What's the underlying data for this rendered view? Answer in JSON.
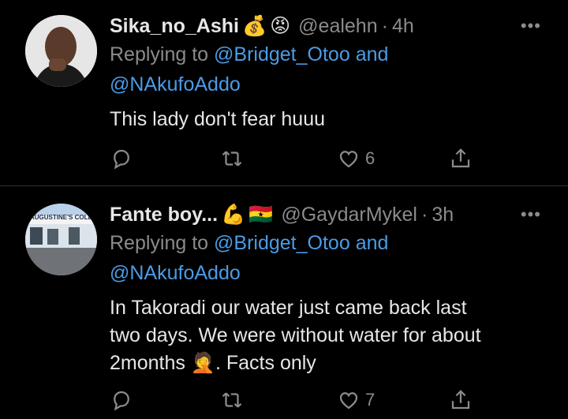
{
  "tweets": [
    {
      "name": "Sika_no_Ashi",
      "emojis": [
        "💰",
        "😡"
      ],
      "handle": "@ealehn",
      "time": "4h",
      "replying_prefix": "Replying to",
      "mention1": "@Bridget_Otoo",
      "and": "and",
      "mention2": "@NAkufoAddo",
      "text": "This lady don't fear huuu",
      "likes": "6"
    },
    {
      "name": "Fante boy...",
      "emojis": [
        "💪",
        "🇬🇭"
      ],
      "handle": "@GaydarMykel",
      "time": "3h",
      "replying_prefix": "Replying to",
      "mention1": "@Bridget_Otoo",
      "and": "and",
      "mention2": "@NAkufoAddo",
      "text_line1": "In Takoradi our water just came back last",
      "text_line2": "two days. We were without water for about",
      "text_line3": "2months",
      "text_tail": ". Facts only",
      "text_emoji": "🤦",
      "likes": "7",
      "avatar_sign": "AUGUSTINE'S COLLE"
    }
  ],
  "more_label": "•••",
  "dot": "·"
}
